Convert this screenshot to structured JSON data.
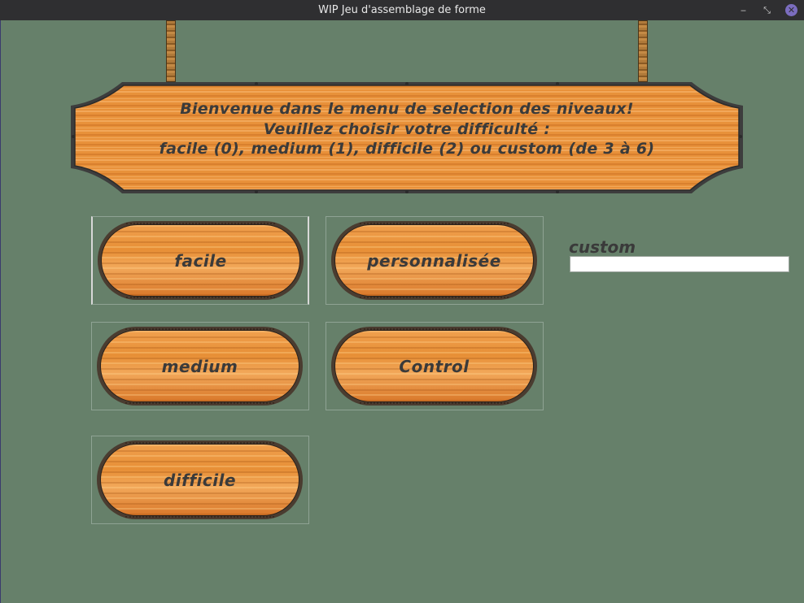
{
  "window": {
    "title": "WIP Jeu d'assemblage de forme",
    "minimize_glyph": "‒",
    "maximize_glyph": "⤡",
    "close_glyph": "✕"
  },
  "sign": {
    "line1": "Bienvenue dans le menu de selection des niveaux!",
    "line2": "Veuillez choisir votre difficulté :",
    "line3": "facile (0), medium (1), difficile (2) ou custom (de 3 à 6)"
  },
  "buttons": {
    "facile": "facile",
    "medium": "medium",
    "difficile": "difficile",
    "personnalisee": "personnalisée",
    "control": "Control"
  },
  "custom": {
    "label": "custom",
    "value": ""
  },
  "colors": {
    "background": "#66806a",
    "wood": "#e78f36",
    "text": "#3a3a3a"
  }
}
